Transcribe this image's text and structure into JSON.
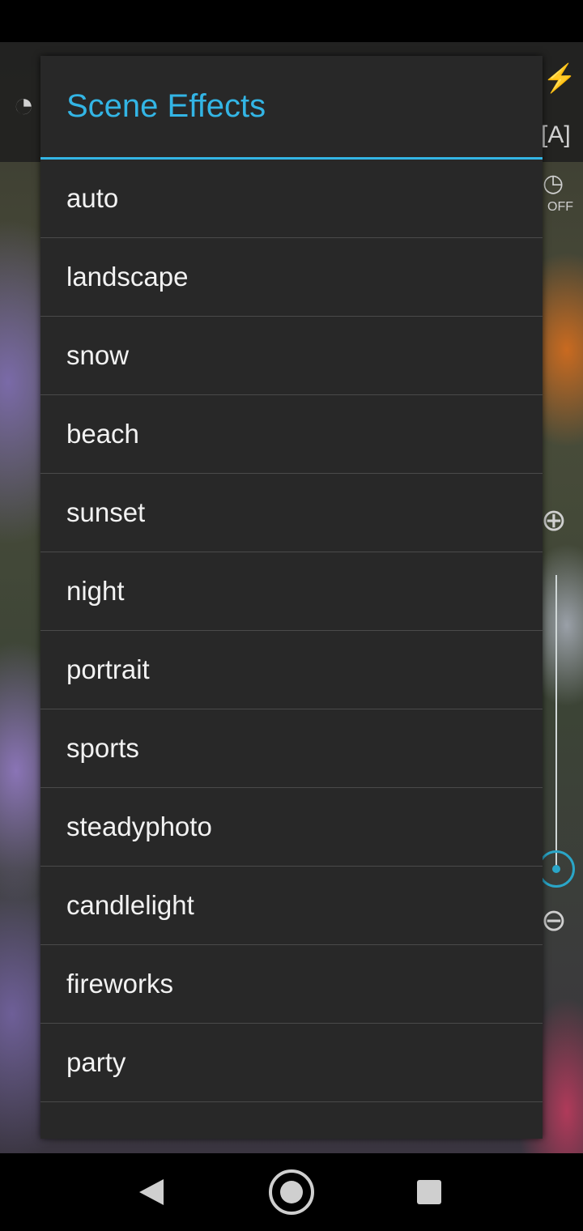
{
  "dialog": {
    "title": "Scene Effects",
    "options": [
      "auto",
      "landscape",
      "snow",
      "beach",
      "sunset",
      "night",
      "portrait",
      "sports",
      "steadyphoto",
      "candlelight",
      "fireworks",
      "party"
    ]
  },
  "camera": {
    "flash_icon": "flash-off-icon",
    "af_icon": "auto-focus-icon",
    "timer_icon": "timer-off-icon",
    "timer_label": "OFF",
    "zoom_in_icon": "zoom-in-icon",
    "zoom_out_icon": "zoom-out-icon",
    "accent_color": "#33b5e5"
  },
  "nav": {
    "back_icon": "back-icon",
    "home_icon": "home-icon",
    "recents_icon": "recents-icon"
  }
}
